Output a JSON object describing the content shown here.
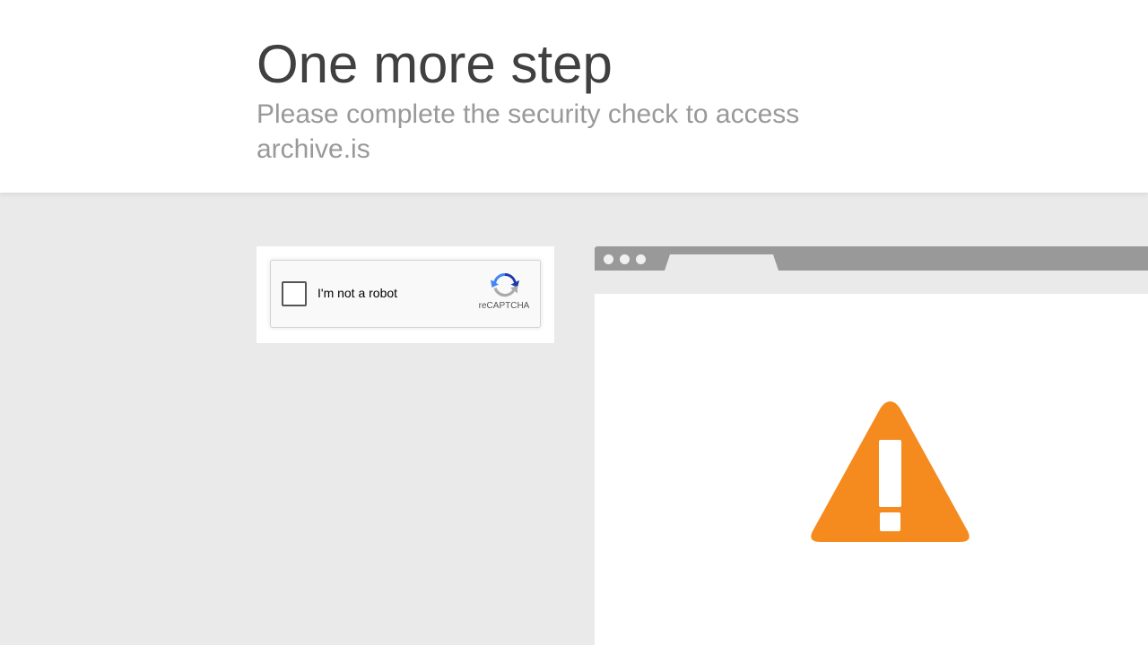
{
  "header": {
    "title": "One more step",
    "subtitle": "Please complete the security check to access archive.is"
  },
  "recaptcha": {
    "checkbox_label": "I'm not a robot",
    "brand": "reCAPTCHA",
    "checked": false
  },
  "browser": {
    "dots": [
      "window-dot",
      "window-dot",
      "window-dot"
    ],
    "icon": "warning-icon"
  },
  "colors": {
    "background": "#eaeaea",
    "header": "#ffffff",
    "title": "#404040",
    "subtitle": "#999999",
    "browser_bar": "#999999",
    "warning": "#f58a1f"
  }
}
